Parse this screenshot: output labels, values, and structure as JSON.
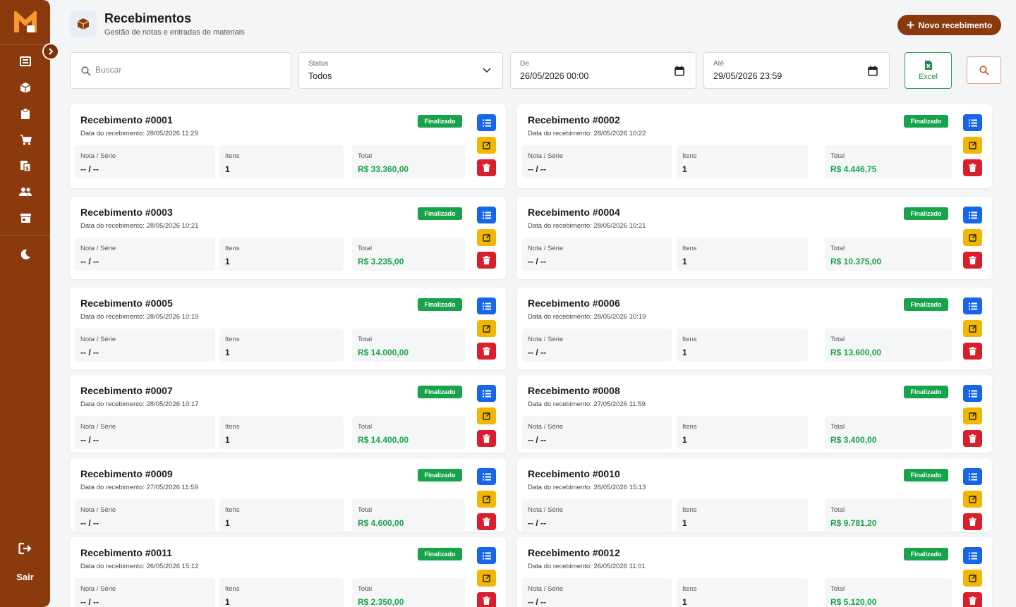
{
  "sidebar": {
    "logout_label": "Sair"
  },
  "header": {
    "title": "Recebimentos",
    "subtitle": "Gestão de notas e entradas de materiais",
    "new_button_label": "Novo recebimento"
  },
  "filters": {
    "search_placeholder": "Buscar",
    "status_label": "Status",
    "status_value": "Todos",
    "from_label": "De",
    "from_value": "26/05/2026 00:00",
    "to_label": "Até",
    "to_value": "29/05/2026 23:59",
    "excel_label": "Excel"
  },
  "labels": {
    "nota": "Nota / Série",
    "itens": "Itens",
    "total": "Total",
    "status": "Finalizado",
    "date_prefix": "Data do recebimento: "
  },
  "colors": {
    "brand": "#8b3a0e",
    "success": "#17a34a",
    "primary": "#1766e8",
    "warning": "#f2b705",
    "danger": "#d81f2e"
  },
  "receipts": [
    {
      "title": "Recebimento #0001",
      "date": "28/05/2026 11:29",
      "nota": "-- / --",
      "itens": "1",
      "total": "R$ 33.360,00"
    },
    {
      "title": "Recebimento #0002",
      "date": "28/05/2026 10:22",
      "nota": "-- / --",
      "itens": "1",
      "total": "R$ 4.446,75"
    },
    {
      "title": "Recebimento #0003",
      "date": "28/05/2026 10:21",
      "nota": "-- / --",
      "itens": "1",
      "total": "R$ 3.235,00"
    },
    {
      "title": "Recebimento #0004",
      "date": "28/05/2026 10:21",
      "nota": "-- / --",
      "itens": "1",
      "total": "R$ 10.375,00"
    },
    {
      "title": "Recebimento #0005",
      "date": "28/05/2026 10:19",
      "nota": "-- / --",
      "itens": "1",
      "total": "R$ 14.000,00"
    },
    {
      "title": "Recebimento #0006",
      "date": "28/05/2026 10:19",
      "nota": "-- / --",
      "itens": "1",
      "total": "R$ 13.600,00"
    },
    {
      "title": "Recebimento #0007",
      "date": "28/05/2026 10:17",
      "nota": "-- / --",
      "itens": "1",
      "total": "R$ 14.400,00"
    },
    {
      "title": "Recebimento #0008",
      "date": "27/05/2026 11:59",
      "nota": "-- / --",
      "itens": "1",
      "total": "R$ 3.400,00"
    },
    {
      "title": "Recebimento #0009",
      "date": "27/05/2026 11:59",
      "nota": "-- / --",
      "itens": "1",
      "total": "R$ 4.600,00"
    },
    {
      "title": "Recebimento #0010",
      "date": "26/05/2026 15:13",
      "nota": "-- / --",
      "itens": "1",
      "total": "R$ 9.781,20"
    },
    {
      "title": "Recebimento #0011",
      "date": "26/05/2026 15:12",
      "nota": "-- / --",
      "itens": "1",
      "total": "R$ 2.350,00"
    },
    {
      "title": "Recebimento #0012",
      "date": "26/05/2026 11:01",
      "nota": "-- / --",
      "itens": "1",
      "total": "R$ 5.120,00"
    }
  ]
}
